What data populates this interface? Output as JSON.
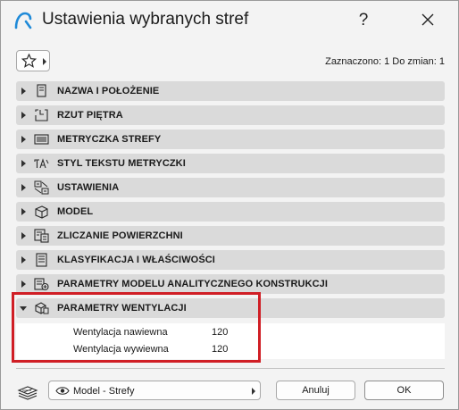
{
  "window": {
    "title": "Ustawienia wybranych stref",
    "help_label": "?",
    "accent_color": "#1f8ad8",
    "highlight_color": "#d01e25"
  },
  "toolbar": {
    "favorites_icon": "star-icon",
    "status": "Zaznaczono: 1 Do zmian: 1"
  },
  "panels": [
    {
      "label": "NAZWA I POŁOŻENIE",
      "icon": "name-position-icon",
      "expanded": false
    },
    {
      "label": "RZUT PIĘTRA",
      "icon": "floor-plan-icon",
      "expanded": false
    },
    {
      "label": "METRYCZKA STREFY",
      "icon": "zone-stamp-icon",
      "expanded": false
    },
    {
      "label": "STYL TEKSTU METRYCZKI",
      "icon": "text-style-icon",
      "expanded": false
    },
    {
      "label": "USTAWIENIA",
      "icon": "settings-icon",
      "expanded": false
    },
    {
      "label": "MODEL",
      "icon": "model-icon",
      "expanded": false
    },
    {
      "label": "ZLICZANIE POWIERZCHNI",
      "icon": "area-calculation-icon",
      "expanded": false
    },
    {
      "label": "KLASYFIKACJA I WŁAŚCIWOŚCI",
      "icon": "classification-icon",
      "expanded": false
    },
    {
      "label": "PARAMETRY MODELU ANALITYCZNEGO KONSTRUKCJI",
      "icon": "structural-model-icon",
      "expanded": false
    },
    {
      "label": "PARAMETRY WENTYLACJI",
      "icon": "ventilation-icon",
      "expanded": true
    }
  ],
  "ventilation": {
    "rows": [
      {
        "label": "Wentylacja nawiewna",
        "value": "120"
      },
      {
        "label": "Wentylacja wywiewna",
        "value": "120"
      }
    ]
  },
  "footer": {
    "layer_icon": "layers-icon",
    "view_select": "Model - Strefy",
    "cancel_label": "Anuluj",
    "ok_label": "OK"
  }
}
